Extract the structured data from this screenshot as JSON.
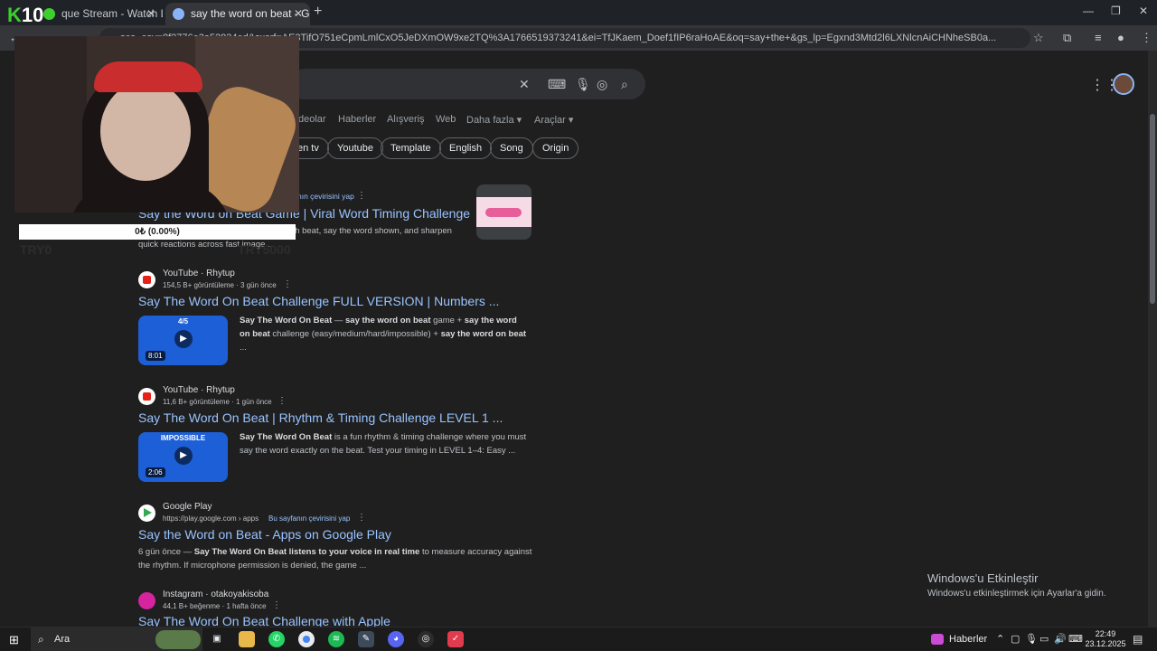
{
  "browser": {
    "tabs": [
      {
        "label": "que Stream - Watch Live o"
      },
      {
        "label": "say the word on beat - Google"
      }
    ],
    "new_tab": "+",
    "url": "...sca_esv=8f2776e3a52834ed&sxsrf=AE3TifO751eCpmLmlCxO5JeDXmOW9xe2TQ%3A1766519373241&ei=TfJKaem_Doef1fIP6raHoAE&oq=say+the+&gs_lp=Egxnd3Mtd2l6LXNlcnAiCHNheSB0a..."
  },
  "google": {
    "nav": [
      "deolar",
      "Haberler",
      "Alışveriş",
      "Web",
      "Daha fazla ▾",
      "Araçlar ▾"
    ],
    "chips": [
      "en tv",
      "Youtube",
      "Template",
      "English",
      "Song",
      "Origin"
    ],
    "results": [
      {
        "translate": "nın çevirisini yap",
        "title": "Say the Word on Beat Game | Viral Word Timing Challenge",
        "snippet": "e, the viral word timing challenge. Hit each beat, say the word shown, and sharpen quick reactions across fast image ..."
      },
      {
        "source": "YouTube · Rhytup",
        "meta": "154,5 B+ görüntüleme · 3 gün önce",
        "title": "Say The Word On Beat Challenge FULL VERSION | Numbers ...",
        "thumb_label": "4/5",
        "duration": "8:01",
        "snippet_bold1": "Say The Word On Beat",
        "snippet_mid1": " — ",
        "snippet_bold2": "say the word on beat",
        "snippet_mid2": " game + ",
        "snippet_bold3": "say the word on beat",
        "snippet_mid3": " challenge (easy/medium/hard/impossible) + ",
        "snippet_bold4": "say the word on beat",
        "snippet_end": " ..."
      },
      {
        "source": "YouTube · Rhytup",
        "meta": "11,6 B+ görüntüleme · 1 gün önce",
        "title": "Say The Word On Beat | Rhythm & Timing Challenge LEVEL 1 ...",
        "thumb_label": "IMPOSSIBLE",
        "duration": "2:06",
        "snippet_bold1": "Say The Word On Beat",
        "snippet_rest": " is a fun rhythm & timing challenge where you must say the word exactly on the beat. Test your timing in LEVEL 1–4: Easy ..."
      },
      {
        "source": "Google Play",
        "meta": "https://play.google.com › apps",
        "translate": "Bu sayfanın çevirisini yap",
        "title": "Say the Word on Beat - Apps on Google Play",
        "snippet_pre": "6 gün önce — ",
        "snippet_bold1": "Say The Word On Beat listens to your voice in real time",
        "snippet_rest": " to measure accuracy against the rhythm. If microphone permission is denied, the game ..."
      },
      {
        "source": "Instagram · otakoyakisoba",
        "meta": "44,1 B+ beğenme · 1 hafta önce",
        "title": "Say The Word On Beat Challenge with Apple"
      }
    ]
  },
  "stream_overlay": {
    "logo_k": "K",
    "logo_num": "10",
    "donation_bar": "0₺ (0.00%)",
    "donation_left": "TRY0",
    "donation_right": "TRY5000"
  },
  "windows": {
    "activate_title": "Windows'u Etkinleştir",
    "activate_sub": "Windows'u etkinleştirmek için Ayarlar'a gidin."
  },
  "taskbar": {
    "search_placeholder": "Ara",
    "news": "Haberler",
    "time": "22:49",
    "date": "23.12.2025"
  },
  "colors": {
    "link": "#99c3ff",
    "page_bg": "#1f1f1f",
    "logo_green": "#3ccf2e"
  }
}
